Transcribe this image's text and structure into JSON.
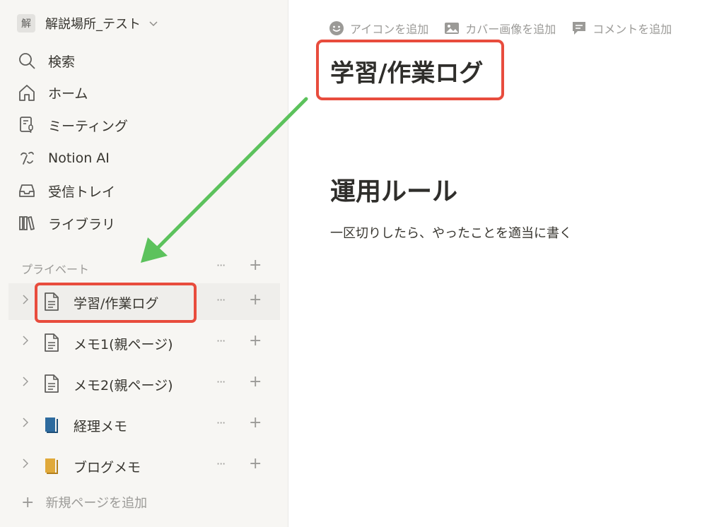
{
  "workspace": {
    "badge": "解",
    "name": "解説場所_テスト"
  },
  "nav": {
    "search": "検索",
    "home": "ホーム",
    "meetings": "ミーティング",
    "notion_ai": "Notion AI",
    "inbox": "受信トレイ",
    "library": "ライブラリ"
  },
  "private_section": {
    "label": "プライベート",
    "more": "···",
    "add": "+"
  },
  "pages": [
    {
      "label": "学習/作業ログ",
      "icon": "page-icon",
      "active": true
    },
    {
      "label": "メモ1(親ページ)",
      "icon": "page-icon"
    },
    {
      "label": "メモ2(親ページ)",
      "icon": "page-icon"
    },
    {
      "label": "経理メモ",
      "icon": "blue-book-icon",
      "color": "#2e6b9e"
    },
    {
      "label": "ブログメモ",
      "icon": "yellow-book-icon",
      "color": "#d29b2e"
    }
  ],
  "add_page": {
    "label": "新規ページを追加"
  },
  "main": {
    "actions": {
      "add_icon": "アイコンを追加",
      "add_cover": "カバー画像を追加",
      "add_comment": "コメントを追加"
    },
    "title": "学習/作業ログ",
    "heading": "運用ルール",
    "paragraph": "一区切りしたら、やったことを適当に書く"
  },
  "colors": {
    "highlight": "#e84c3d",
    "arrow": "#5cc25c",
    "sidebar_bg": "#f7f6f3"
  }
}
